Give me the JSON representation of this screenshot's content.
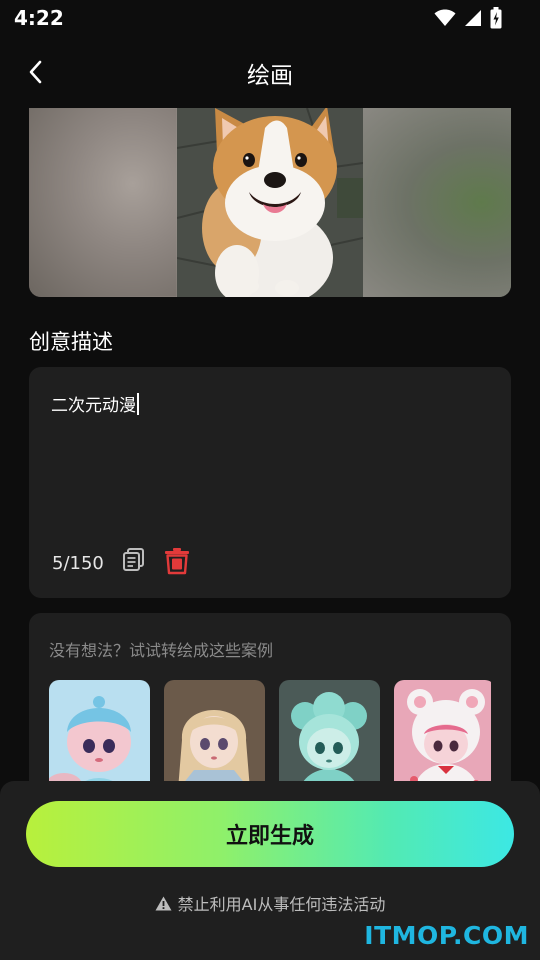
{
  "status_bar": {
    "time": "4:22"
  },
  "header": {
    "title": "绘画"
  },
  "prompt": {
    "section_title": "创意描述",
    "text": "二次元动漫",
    "char_count": "5/150"
  },
  "examples": {
    "hint": "没有想法？试试转绘成这些案例"
  },
  "footer": {
    "generate_label": "立即生成",
    "disclaimer": "禁止利用AI从事任何违法活动"
  },
  "watermark": {
    "text": "ITMOP.COM"
  },
  "colors": {
    "background": "#0d0d0d",
    "card": "#1f1f1f",
    "accent_green": "#b8f03c",
    "accent_cyan": "#3ce8e4",
    "danger_red": "#e23a3a",
    "watermark_blue": "#1fb6e0"
  },
  "icons": [
    "back-icon",
    "wifi-icon",
    "signal-icon",
    "battery-icon",
    "copy-icon",
    "trash-icon",
    "warning-icon"
  ]
}
